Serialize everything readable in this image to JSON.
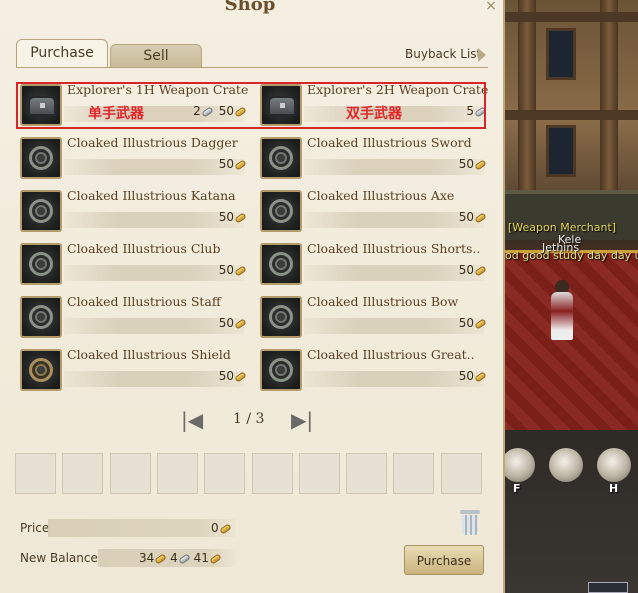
{
  "shop": {
    "title": "Shop",
    "tabs": [
      {
        "label": "Purchase",
        "active": true
      },
      {
        "label": "Sell",
        "active": false
      }
    ],
    "buyback_label": "Buyback List",
    "items": [
      {
        "name": "Explorer's 1H Weapon Crate",
        "icon": "crate-icon",
        "price": {
          "silver": "2",
          "gold": "50"
        },
        "annotation": "单手武器"
      },
      {
        "name": "Explorer's 2H Weapon Crate",
        "icon": "crate-icon",
        "price": {
          "silver": "5"
        },
        "annotation": "双手武器"
      },
      {
        "name": "Cloaked Illustrious Dagger",
        "icon": "emblem-icon",
        "price": {
          "gold": "50"
        }
      },
      {
        "name": "Cloaked Illustrious Sword",
        "icon": "emblem-icon",
        "price": {
          "gold": "50"
        }
      },
      {
        "name": "Cloaked Illustrious Katana",
        "icon": "emblem-icon",
        "price": {
          "gold": "50"
        }
      },
      {
        "name": "Cloaked Illustrious Axe",
        "icon": "emblem-icon",
        "price": {
          "gold": "50"
        }
      },
      {
        "name": "Cloaked Illustrious Club",
        "icon": "emblem-icon",
        "price": {
          "gold": "50"
        }
      },
      {
        "name": "Cloaked Illustrious Shorts..",
        "icon": "emblem-icon",
        "price": {
          "gold": "50"
        }
      },
      {
        "name": "Cloaked Illustrious Staff",
        "icon": "emblem-icon",
        "price": {
          "gold": "50"
        }
      },
      {
        "name": "Cloaked Illustrious Bow",
        "icon": "emblem-icon",
        "price": {
          "gold": "50"
        }
      },
      {
        "name": "Cloaked Illustrious Shield",
        "icon": "shield-emblem-icon",
        "price": {
          "gold": "50"
        }
      },
      {
        "name": "Cloaked Illustrious Great..",
        "icon": "emblem-icon",
        "price": {
          "gold": "50"
        }
      }
    ],
    "pagination": {
      "text": "1 / 3"
    },
    "price": {
      "label": "Price",
      "value": "0"
    },
    "balance": {
      "label": "New Balance",
      "gold": "34",
      "silver": "4",
      "copper": "41"
    },
    "purchase_button": "Purchase"
  },
  "world": {
    "npc_title": "[Weapon Merchant]",
    "npc_name1": "Kele",
    "npc_name2": "Jethins",
    "npc_chat": "od good study day day up",
    "hotkeys": [
      "F",
      "H"
    ]
  },
  "colors": {
    "annotation_red": "#d9242a",
    "panel_bg": "#f4efe1"
  }
}
